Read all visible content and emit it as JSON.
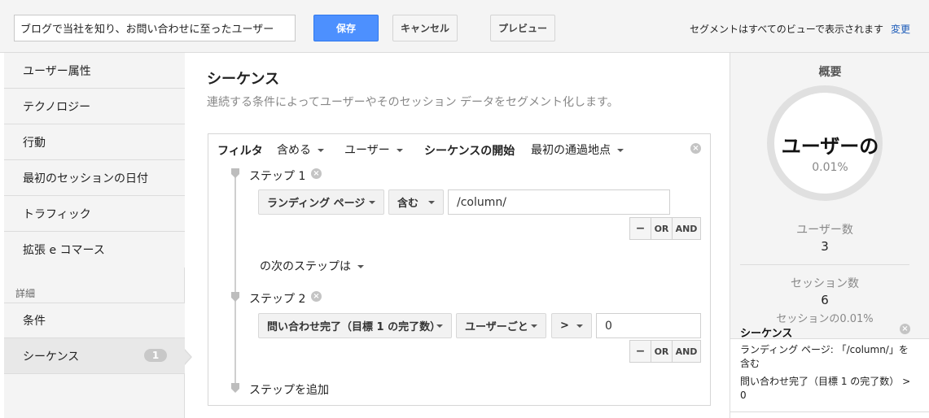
{
  "topbar": {
    "segment_name": "ブログで当社を知り、お問い合わせに至ったユーザー",
    "save_label": "保存",
    "cancel_label": "キャンセル",
    "preview_label": "プレビュー",
    "visibility_note": "セグメントはすべてのビューで表示されます",
    "change_link": "変更"
  },
  "sidebar": {
    "items": [
      {
        "label": "ユーザー属性"
      },
      {
        "label": "テクノロジー"
      },
      {
        "label": "行動"
      },
      {
        "label": "最初のセッションの日付"
      },
      {
        "label": "トラフィック"
      },
      {
        "label": "拡張 e コマース"
      }
    ],
    "advanced_heading": "詳細",
    "advanced_items": [
      {
        "label": "条件"
      },
      {
        "label": "シーケンス",
        "badge": "1"
      }
    ]
  },
  "main": {
    "title": "シーケンス",
    "description": "連続する条件によってユーザーやそのセッション データをセグメント化します。",
    "filter": {
      "label": "フィルタ",
      "include": "含める",
      "scope": "ユーザー",
      "sequence_start_label": "シーケンスの開始",
      "sequence_start_value": "最初の通過地点"
    },
    "steps": [
      {
        "label": "ステップ 1",
        "dimension": "ランディング ページ",
        "operator": "含む",
        "value": "/column/"
      },
      {
        "label": "ステップ 2",
        "dimension": "問い合わせ完了（目標 1 の完了数）",
        "per": "ユーザーごと",
        "operator": ">",
        "value": "0"
      }
    ],
    "next_step_label": "の次のステップは",
    "add_step_label": "ステップを追加",
    "minus_label": "−",
    "or_label": "OR",
    "and_label": "AND",
    "remove_glyph": "×"
  },
  "summary": {
    "title": "概要",
    "ring_label": "ユーザーの",
    "ring_percent": "0.01%",
    "users_label": "ユーザー数",
    "users_value": "3",
    "sessions_label": "セッション数",
    "sessions_value": "6",
    "sessions_percent": "セッションの0.01%",
    "sequence_title": "シーケンス",
    "sequence_line1": "ランディング ページ: 「/column/」を含む",
    "sequence_line2": "問い合わせ完了（目標 1 の完了数） > 0"
  }
}
